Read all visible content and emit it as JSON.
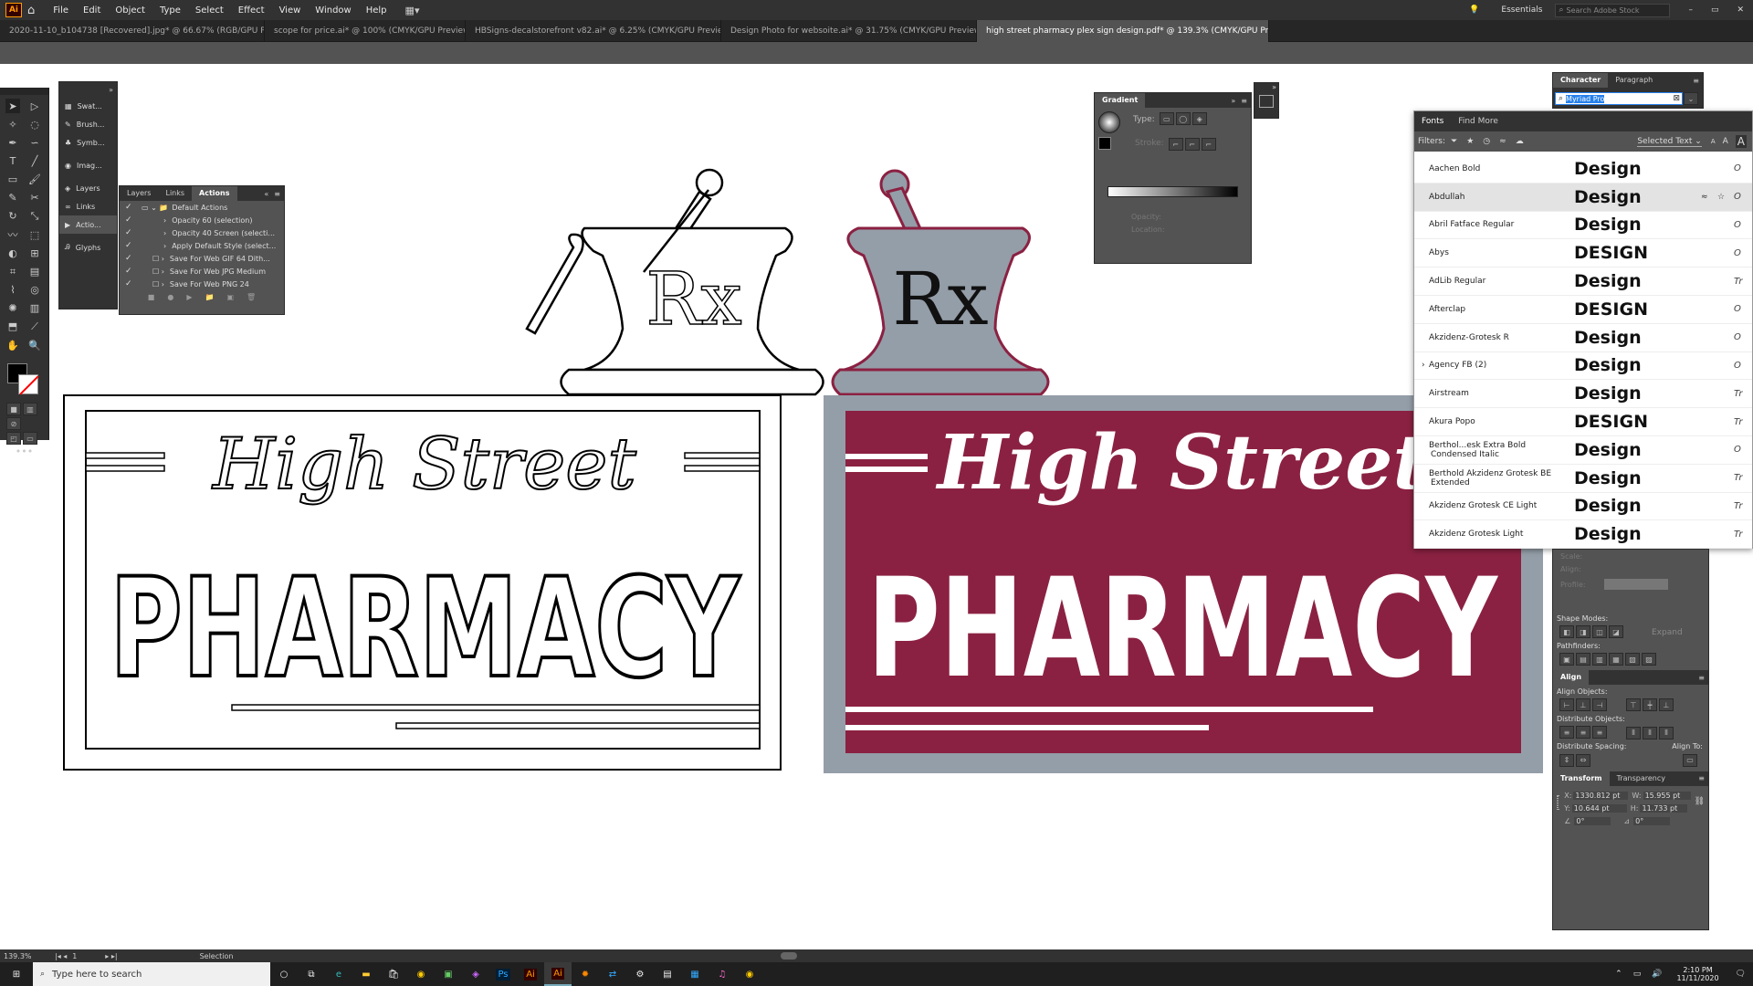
{
  "menu": {
    "items": [
      "File",
      "Edit",
      "Object",
      "Type",
      "Select",
      "Effect",
      "View",
      "Window",
      "Help"
    ],
    "workspace": "Essentials",
    "search_placeholder": "Search Adobe Stock",
    "app_badge": "Ai"
  },
  "tabs": [
    {
      "label": "2020-11-10_b104738 [Recovered].jpg* @ 66.67% (RGB/GPU Preview)",
      "active": false
    },
    {
      "label": "scope for price.ai* @ 100% (CMYK/GPU Preview)",
      "active": false
    },
    {
      "label": "HBSigns-decalstorefront v82.ai* @ 6.25% (CMYK/GPU Preview)",
      "active": false
    },
    {
      "label": "Design Photo for websoite.ai* @ 31.75% (CMYK/GPU Preview)",
      "active": false
    },
    {
      "label": "high street pharmacy plex sign design.pdf* @ 139.3% (CMYK/GPU Preview)",
      "active": true
    }
  ],
  "side_dock": {
    "items": [
      "Swat...",
      "Brush...",
      "Symb...",
      "Imag...",
      "Layers",
      "Links",
      "Actio...",
      "Glyphs"
    ]
  },
  "actions_panel": {
    "tabs": [
      "Layers",
      "Links",
      "Actions"
    ],
    "set": "Default Actions",
    "items": [
      "Opacity 60 (selection)",
      "Opacity 40 Screen (selecti...",
      "Apply Default Style (select...",
      "Save For Web GIF 64 Dith...",
      "Save For Web JPG Medium",
      "Save For Web PNG 24"
    ]
  },
  "gradient_panel": {
    "title": "Gradient",
    "type_label": "Type:",
    "stroke_label": "Stroke:",
    "opacity_label": "Opacity:",
    "location_label": "Location:"
  },
  "character_panel": {
    "tabs": [
      "Character",
      "Paragraph"
    ],
    "font_value": "Myriad Pro"
  },
  "fonts_panel": {
    "tabs": [
      "Fonts",
      "Find More"
    ],
    "filters_label": "Filters:",
    "selected_text": "Selected Text",
    "sample_letters": [
      "A",
      "A",
      "A"
    ],
    "fonts": [
      {
        "name": "Aachen Bold",
        "sample": "Design",
        "icon": "O"
      },
      {
        "name": "Abdullah",
        "sample": "Design",
        "icon": "O"
      },
      {
        "name": "Abril Fatface Regular",
        "sample": "Design",
        "icon": "O"
      },
      {
        "name": "Abys",
        "sample": "DESIGN",
        "icon": "O"
      },
      {
        "name": "AdLib Regular",
        "sample": "Design",
        "icon": "Tr"
      },
      {
        "name": "Afterclap",
        "sample": "DESIGN",
        "icon": "O"
      },
      {
        "name": "Akzidenz-Grotesk  R",
        "sample": "Design",
        "icon": "O"
      },
      {
        "name": "Agency FB (2)",
        "sample": "Design",
        "icon": "O"
      },
      {
        "name": "Airstream",
        "sample": "Design",
        "icon": "Tr"
      },
      {
        "name": "Akura Popo",
        "sample": "DESIGN",
        "icon": "Tr"
      },
      {
        "name": "Berthol...esk Extra Bold Condensed Italic",
        "sample": "Design",
        "icon": "O"
      },
      {
        "name": "Berthold Akzidenz Grotesk BE Extended",
        "sample": "Design",
        "icon": "Tr"
      },
      {
        "name": "Akzidenz Grotesk CE Light",
        "sample": "Design",
        "icon": "Tr"
      },
      {
        "name": "Akzidenz Grotesk Light",
        "sample": "Design",
        "icon": "Tr"
      }
    ]
  },
  "right_panels": {
    "scale_label": "Scale:",
    "align_label": "Align:",
    "profile_label": "Profile:",
    "shape_modes": "Shape Modes:",
    "pathfinders": "Pathfinders:",
    "expand": "Expand",
    "align_title": "Align",
    "align_objects": "Align Objects:",
    "distribute_objects": "Distribute Objects:",
    "distribute_spacing": "Distribute Spacing:",
    "align_to": "Align To:",
    "transform_tabs": [
      "Transform",
      "Transparency"
    ],
    "x": "1330.812 pt",
    "y": "10.644 pt",
    "w": "15.955 pt",
    "h": "11.733 pt",
    "rot": "0°",
    "shear": "0°",
    "x_label": "X:",
    "y_label": "Y:",
    "w_label": "W:",
    "h_label": "H:"
  },
  "sign": {
    "line1": "High Street",
    "line2": "PHARMACY",
    "rx": "Rx"
  },
  "colors": {
    "maroon": "#8b2142",
    "grey": "#949ea8",
    "ui_dark": "#323232",
    "ui_mid": "#535353"
  },
  "status": {
    "zoom": "139.3%",
    "page": "1",
    "tool": "Selection"
  },
  "taskbar": {
    "search_placeholder": "Type here to search",
    "time": "2:10 PM",
    "date": "11/11/2020",
    "apps": [
      "Ps",
      "Ai",
      "Ai"
    ]
  }
}
